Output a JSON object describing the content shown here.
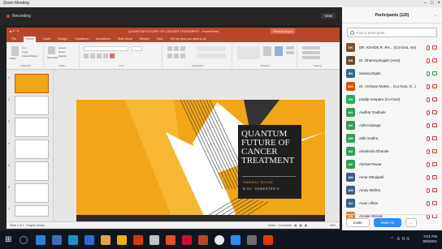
{
  "zoom": {
    "window_title": "Zoom Meeting",
    "recording_label": "Recording",
    "view_label": "View"
  },
  "powerpoint": {
    "doc_title": "QUANTUM FUTURE OF CANCER TREATMENT - PowerPoint",
    "user": "Swaraj Dighe",
    "tabs": [
      "File",
      "Home",
      "Insert",
      "Design",
      "Transitions",
      "Animations",
      "Slide Show",
      "Review",
      "View",
      "Tell me what you want to do"
    ],
    "active_tab": "Home",
    "ribbon_groups": [
      "Clipboard",
      "Slides",
      "Font",
      "Paragraph",
      "Drawing",
      "Editing"
    ],
    "clipboard": {
      "paste": "Paste",
      "cut": "Cut",
      "copy": "Copy",
      "format_painter": "Format Painter"
    },
    "slides_group": {
      "new_slide": "New Slide",
      "layout": "Layout",
      "reset": "Reset",
      "section": "Section"
    },
    "slide_numbers": [
      "1",
      "2",
      "3",
      "4",
      "5",
      "6",
      "7"
    ],
    "slide": {
      "title_lines": [
        "QUANTUM",
        "FUTURE OF",
        "CANCER",
        "TREATMENT"
      ],
      "author": "SWARAJ DIGHE",
      "course": "B.SC. SEMESTER 5",
      "accent": "#f2a516"
    },
    "status": {
      "slide_info": "Slide 1 of 7",
      "language": "English (India)",
      "notes": "Notes",
      "comments": "Comments",
      "zoom": "63%"
    }
  },
  "participants": {
    "title": "Participants (120)",
    "search_placeholder": "Find a participant",
    "list": [
      {
        "initials": "DK",
        "name": "DR. KHADE R. RA...  (Co-host, me)",
        "color": "#7a5230",
        "mic": "off",
        "cam": "off"
      },
      {
        "initials": "DB",
        "name": "Dr. Dhanraj Bugde (Host)",
        "color": "#6b4a2e",
        "mic": "off",
        "cam": "off"
      },
      {
        "initials": "SD",
        "name": "Swaraj Dighe",
        "color": "#2f6d8a",
        "mic": "on",
        "cam": "on"
      },
      {
        "initials": "DM",
        "name": "Dr. Archana Molek... (Co-host, G...)",
        "color": "#d35400",
        "mic": "off",
        "cam": "off"
      },
      {
        "initials": "PS",
        "name": "pradip tompare (Co-host)",
        "color": "#27ae60",
        "mic": "off",
        "cam": "off"
      },
      {
        "initials": "AG",
        "name": "Aadhar Gadbole",
        "color": "#2e9e5a",
        "mic": "off",
        "cam": "off"
      },
      {
        "initials": "AK",
        "name": "Aditi Kalanga",
        "color": "#2e9e5a",
        "mic": "off",
        "cam": "off"
      },
      {
        "initials": "AM",
        "name": "aditi madhu",
        "color": "#2e9e5a",
        "mic": "off",
        "cam": "off"
      },
      {
        "initials": "AD",
        "name": "Akanksha Dhande",
        "color": "#2e9e5a",
        "mic": "off",
        "cam": "off"
      },
      {
        "initials": "AP",
        "name": "Akshat Pawar",
        "color": "#2e9e5a",
        "mic": "off",
        "cam": "off"
      },
      {
        "initials": "AM",
        "name": "Amar Mhaipatil",
        "color": "#3b5f8a",
        "mic": "off",
        "cam": "off"
      },
      {
        "initials": "AM",
        "name": "Amey Mishra",
        "color": "#445f86",
        "mic": "off",
        "cam": "off"
      },
      {
        "initials": "AU",
        "name": "Anas Ulhas",
        "color": "#3b5f8a",
        "mic": "off",
        "cam": "off"
      },
      {
        "initials": "AS",
        "name": "Annike Shinde",
        "color": "#e67e22",
        "mic": "off",
        "cam": "off"
      }
    ],
    "invite_label": "Invite",
    "mute_all_label": "Mute All",
    "more_label": "..."
  },
  "taskbar": {
    "tray": "^ ENG",
    "time": "3:01 PM",
    "date": "9/8/2021"
  }
}
